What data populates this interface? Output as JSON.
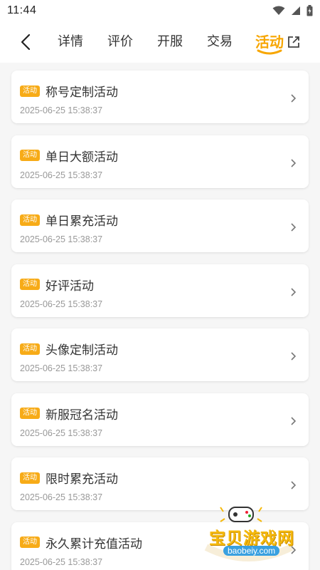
{
  "status_bar": {
    "time": "11:44"
  },
  "nav": {
    "tabs": [
      {
        "label": "详情"
      },
      {
        "label": "评价"
      },
      {
        "label": "开服"
      },
      {
        "label": "交易"
      },
      {
        "label": "活动"
      }
    ],
    "active_tab": "活动"
  },
  "activities": [
    {
      "badge": "活动",
      "title": "称号定制活动",
      "time": "2025-06-25 15:38:37"
    },
    {
      "badge": "活动",
      "title": "单日大额活动",
      "time": "2025-06-25 15:38:37"
    },
    {
      "badge": "活动",
      "title": "单日累充活动",
      "time": "2025-06-25 15:38:37"
    },
    {
      "badge": "活动",
      "title": "好评活动",
      "time": "2025-06-25 15:38:37"
    },
    {
      "badge": "活动",
      "title": "头像定制活动",
      "time": "2025-06-25 15:38:37"
    },
    {
      "badge": "活动",
      "title": "新服冠名活动",
      "time": "2025-06-25 15:38:37"
    },
    {
      "badge": "活动",
      "title": "限时累充活动",
      "time": "2025-06-25 15:38:37"
    },
    {
      "badge": "活动",
      "title": "永久累计充值活动",
      "time": "2025-06-25 15:38:37"
    }
  ],
  "watermark": {
    "text": "宝贝游戏网",
    "domain": "baobeiy.com"
  },
  "colors": {
    "accent": "#f7a600",
    "badge": "#f7ab17",
    "background": "#f6f6f6"
  }
}
